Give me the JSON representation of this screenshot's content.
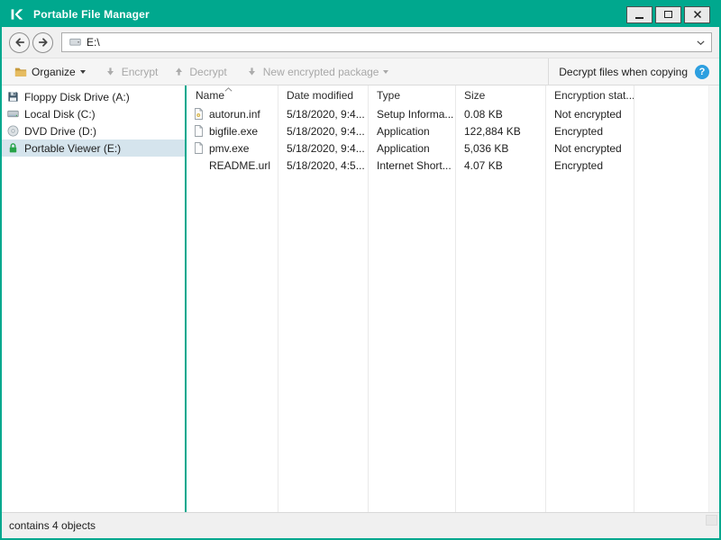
{
  "window": {
    "title": "Portable File Manager"
  },
  "navigation": {
    "address": "E:\\"
  },
  "toolbar": {
    "organize_label": "Organize",
    "encrypt_label": "Encrypt",
    "decrypt_label": "Decrypt",
    "new_package_label": "New encrypted package",
    "decrypt_when_copying_label": "Decrypt files when copying",
    "help_glyph": "?"
  },
  "sidebar": {
    "items": [
      {
        "label": "Floppy Disk Drive (A:)",
        "icon": "floppy-disk-icon",
        "selected": false
      },
      {
        "label": "Local Disk (C:)",
        "icon": "hard-disk-icon",
        "selected": false
      },
      {
        "label": "DVD Drive (D:)",
        "icon": "dvd-disc-icon",
        "selected": false
      },
      {
        "label": "Portable Viewer (E:)",
        "icon": "green-lock-icon",
        "selected": true
      }
    ]
  },
  "file_list": {
    "columns": {
      "name": "Name",
      "date_modified": "Date modified",
      "type": "Type",
      "size": "Size",
      "encryption_status": "Encryption stat..."
    },
    "sort": "name-ascending",
    "rows": [
      {
        "name": "autorun.inf",
        "date_modified": "5/18/2020, 9:4...",
        "type": "Setup Informa...",
        "size": "0.08 KB",
        "encryption_status": "Not encrypted",
        "icon": "setup-information-file-icon"
      },
      {
        "name": "bigfile.exe",
        "date_modified": "5/18/2020, 9:4...",
        "type": "Application",
        "size": "122,884 KB",
        "encryption_status": "Encrypted",
        "icon": "application-file-icon"
      },
      {
        "name": "pmv.exe",
        "date_modified": "5/18/2020, 9:4...",
        "type": "Application",
        "size": "5,036 KB",
        "encryption_status": "Not encrypted",
        "icon": "application-file-icon"
      },
      {
        "name": "README.url",
        "date_modified": "5/18/2020, 4:5...",
        "type": "Internet Short...",
        "size": "4.07 KB",
        "encryption_status": "Encrypted",
        "icon": "none"
      }
    ]
  },
  "status_bar": {
    "text": "contains 4 objects"
  },
  "colors": {
    "brand_teal": "#00A88E",
    "help_blue": "#2D9FE0",
    "selected_item_bg": "#D5E4ED",
    "disabled_text": "#A8A8A8",
    "folder_gold": "#E6BC60",
    "lock_green": "#27A348"
  }
}
